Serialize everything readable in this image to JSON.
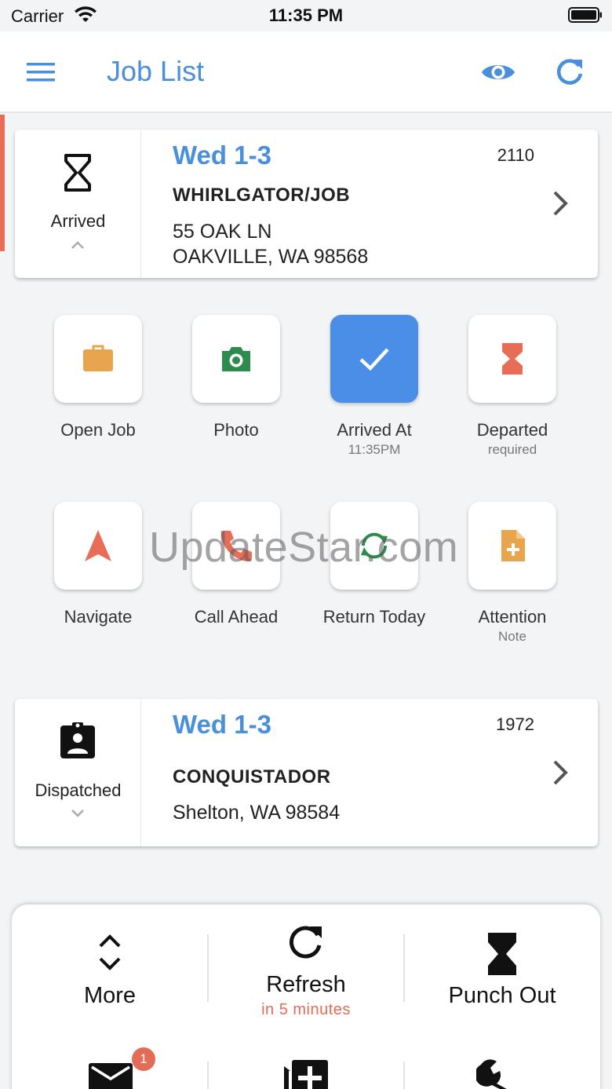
{
  "status_bar": {
    "carrier": "Carrier",
    "time": "11:35 PM"
  },
  "header": {
    "title": "Job List"
  },
  "jobs": [
    {
      "status": "Arrived",
      "window": "Wed 1-3",
      "number": "2110",
      "customer": "WHIRLGATOR/JOB",
      "address_line1": "55 OAK LN",
      "address_line2": "OAKVILLE, WA 98568"
    },
    {
      "status": "Dispatched",
      "window": "Wed 1-3",
      "number": "1972",
      "customer": "CONQUISTADOR",
      "address_line1": "Shelton, WA 98584"
    }
  ],
  "actions": [
    {
      "label": "Open Job",
      "sub": "",
      "icon": "briefcase-icon"
    },
    {
      "label": "Photo",
      "sub": "",
      "icon": "camera-icon"
    },
    {
      "label": "Arrived At",
      "sub": "11:35PM",
      "icon": "check-icon"
    },
    {
      "label": "Departed",
      "sub": "required",
      "icon": "hourglass-icon"
    },
    {
      "label": "Navigate",
      "sub": "",
      "icon": "navigate-arrow-icon"
    },
    {
      "label": "Call Ahead",
      "sub": "",
      "icon": "phone-icon"
    },
    {
      "label": "Return Today",
      "sub": "",
      "icon": "sync-icon"
    },
    {
      "label": "Attention",
      "sub": "Note",
      "icon": "note-add-icon"
    }
  ],
  "watermark": "UpdateStar.com",
  "bottom_bar": {
    "more": "More",
    "refresh": "Refresh",
    "refresh_sub": "in 5 minutes",
    "punch_out": "Punch Out",
    "message_badge": "1"
  },
  "colors": {
    "accent_blue": "#4a8fdc",
    "active_tile": "#4a8ee8",
    "alert_red": "#e26c56",
    "briefcase": "#e9a44e",
    "camera": "#2e8b4e",
    "sync": "#2e8b4e",
    "note": "#e9a44e"
  }
}
